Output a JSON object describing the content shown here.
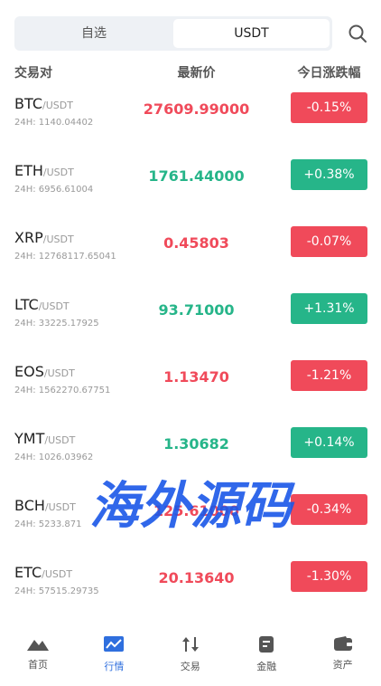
{
  "colors": {
    "up": "#26b589",
    "down": "#f04a5a",
    "active": "#2f6fde"
  },
  "segments": {
    "left": "自选",
    "right": "USDT"
  },
  "headers": {
    "pair": "交易对",
    "price": "最新价",
    "change": "今日涨跌幅"
  },
  "rows": [
    {
      "sym": "BTC",
      "quote": "/USDT",
      "vol": "24H: 1140.04402",
      "price": "27609.99000",
      "change": "-0.15%",
      "dir": "down"
    },
    {
      "sym": "ETH",
      "quote": "/USDT",
      "vol": "24H: 6956.61004",
      "price": "1761.44000",
      "change": "+0.38%",
      "dir": "up"
    },
    {
      "sym": "XRP",
      "quote": "/USDT",
      "vol": "24H: 12768117.65041",
      "price": "0.45803",
      "change": "-0.07%",
      "dir": "down"
    },
    {
      "sym": "LTC",
      "quote": "/USDT",
      "vol": "24H: 33225.17925",
      "price": "93.71000",
      "change": "+1.31%",
      "dir": "up"
    },
    {
      "sym": "EOS",
      "quote": "/USDT",
      "vol": "24H: 1562270.67751",
      "price": "1.13470",
      "change": "-1.21%",
      "dir": "down"
    },
    {
      "sym": "YMT",
      "quote": "/USDT",
      "vol": "24H: 1026.03962",
      "price": "1.30682",
      "change": "+0.14%",
      "dir": "up"
    },
    {
      "sym": "BCH",
      "quote": "/USDT",
      "vol": "24H: 5233.871",
      "price": "125.61000",
      "change": "-0.34%",
      "dir": "down"
    },
    {
      "sym": "ETC",
      "quote": "/USDT",
      "vol": "24H: 57515.29735",
      "price": "20.13640",
      "change": "-1.30%",
      "dir": "down"
    }
  ],
  "tabs": [
    {
      "label": "首页",
      "icon": "mountain-icon",
      "active": false
    },
    {
      "label": "行情",
      "icon": "chart-icon",
      "active": true
    },
    {
      "label": "交易",
      "icon": "trade-arrows-icon",
      "active": false
    },
    {
      "label": "金融",
      "icon": "document-icon",
      "active": false
    },
    {
      "label": "资产",
      "icon": "wallet-icon",
      "active": false
    }
  ],
  "watermark": "海外源码"
}
